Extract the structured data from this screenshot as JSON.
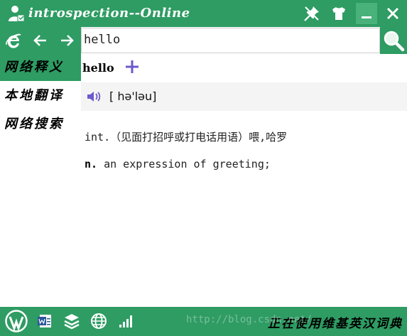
{
  "window": {
    "title": "introspection--Online",
    "accent_color": "#2e9c63",
    "icons": [
      "user-icon",
      "pin-icon",
      "shirt-icon",
      "minimize-icon",
      "close-icon"
    ]
  },
  "nav": {
    "icons": [
      "browser-icon",
      "back-arrow-icon",
      "forward-arrow-icon"
    ]
  },
  "search": {
    "value": "hello",
    "button_icon": "search-icon"
  },
  "sidebar": {
    "items": [
      {
        "label": "网络释义",
        "active": true
      },
      {
        "label": "本地翻译",
        "active": false
      },
      {
        "label": "网络搜索",
        "active": false
      }
    ]
  },
  "entry": {
    "word": "hello",
    "add_icon": "plus-icon",
    "speaker_icon": "speaker-icon",
    "phonetic": "[ hə'ləu]",
    "definitions": [
      {
        "pos": "",
        "text": "int.（见面打招呼或打电话用语）喂,哈罗"
      },
      {
        "pos": "n.",
        "text": " an expression of greeting;"
      }
    ]
  },
  "bottombar": {
    "icons": [
      "wordpress-icon",
      "word-doc-icon",
      "layers-icon",
      "globe-icon",
      "signal-icon"
    ],
    "status": "正在使用维基英汉词典",
    "watermark": "http://blog.csdn.net/"
  }
}
